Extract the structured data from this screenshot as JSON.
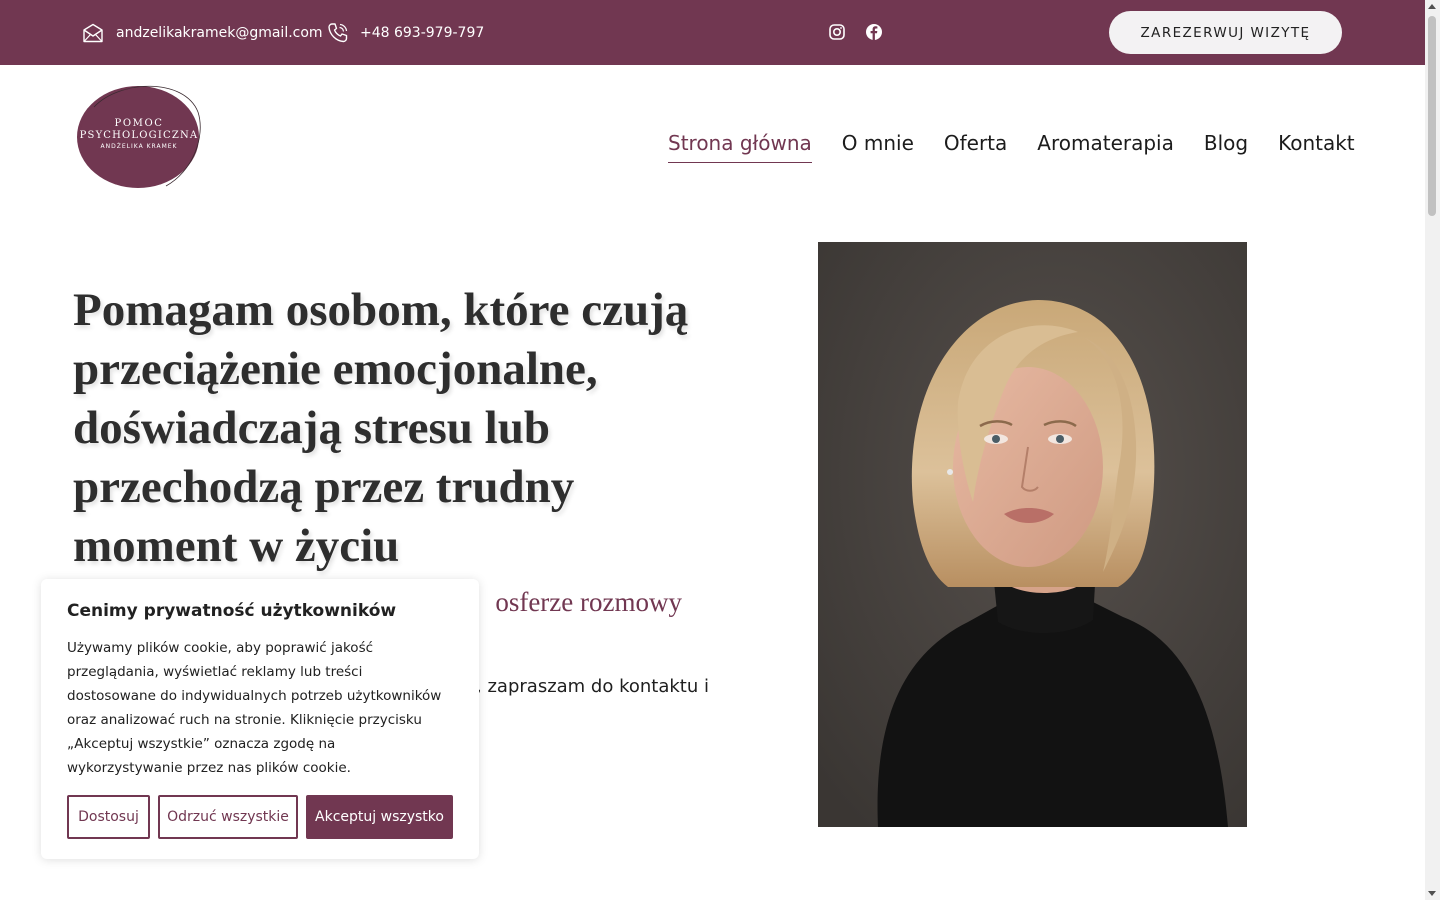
{
  "colors": {
    "brand": "#713751",
    "topbar_text": "#ffffff",
    "heading": "#2e2e2e",
    "button_light": "#f3f2f3"
  },
  "topbar": {
    "email": "andzelikakramek@gmail.com",
    "phone": "+48 693-979-797",
    "social": [
      {
        "name": "instagram-icon"
      },
      {
        "name": "facebook-icon"
      }
    ],
    "book_button": "ZAREZERWUJ WIZYTĘ"
  },
  "logo": {
    "line1": "POMOC",
    "line2": "PSYCHOLOGICZNA",
    "line3": "ANDŻELIKA KRAMEK"
  },
  "nav": {
    "items": [
      {
        "label": "Strona główna",
        "active": true
      },
      {
        "label": "O mnie"
      },
      {
        "label": "Oferta"
      },
      {
        "label": "Aromaterapia"
      },
      {
        "label": "Blog"
      },
      {
        "label": "Kontakt"
      }
    ]
  },
  "hero": {
    "title": "Pomagam osobom, które czują przeciążenie emocjonalne, doświadczają stresu lub przechodzą przez trudny moment w życiu",
    "subtitle": "osferze rozmowy",
    "body": "e, zapraszam do kontaktu i"
  },
  "cookie": {
    "title": "Cenimy prywatność użytkowników",
    "text": "Używamy plików cookie, aby poprawić jakość przeglądania, wyświetlać reklamy lub treści dostosowane do indywidualnych potrzeb użytkowników oraz analizować ruch na stronie. Kliknięcie przycisku „Akceptuj wszystkie” oznacza zgodę na wykorzystywanie przez nas plików cookie.",
    "btn_customize": "Dostosuj",
    "btn_reject": "Odrzuć wszystkie",
    "btn_accept": "Akceptuj wszystko"
  }
}
